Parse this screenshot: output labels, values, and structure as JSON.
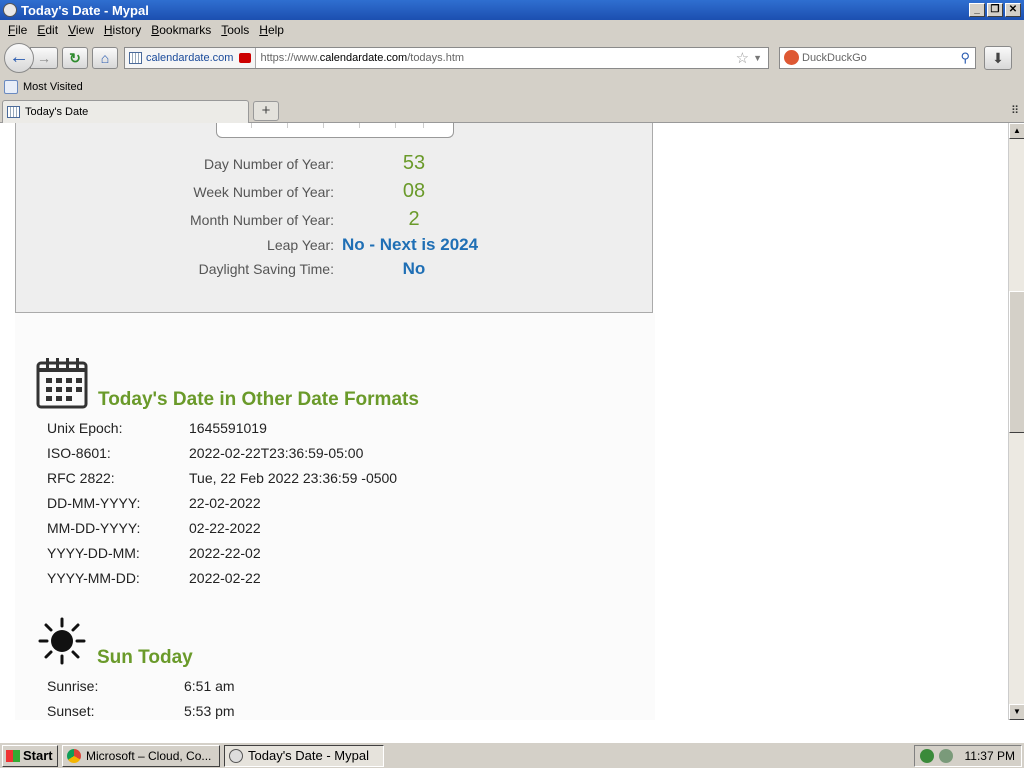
{
  "window": {
    "title": "Today's Date - Mypal"
  },
  "menu": [
    "File",
    "Edit",
    "View",
    "History",
    "Bookmarks",
    "Tools",
    "Help"
  ],
  "navbar": {
    "site_identity": "calendardate.com",
    "url_prefix": "https://www.",
    "url_domain": "calendardate.com",
    "url_path": "/todays.htm",
    "search_placeholder": "DuckDuckGo"
  },
  "bookmarks": {
    "most_visited": "Most Visited"
  },
  "tabs": [
    {
      "label": "Today's Date"
    }
  ],
  "stats": {
    "day_label": "Day Number of Year:",
    "day_value": "53",
    "week_label": "Week Number of Year:",
    "week_value": "08",
    "month_label": "Month Number of Year:",
    "month_value": "2",
    "leap_label": "Leap Year:",
    "leap_value": "No - Next is 2024",
    "dst_label": "Daylight Saving Time:",
    "dst_value": "No"
  },
  "formats": {
    "title": "Today's Date in Other Date Formats",
    "rows": [
      {
        "key": "Unix Epoch:",
        "value": "1645591019"
      },
      {
        "key": "ISO-8601:",
        "value": "2022-02-22T23:36:59-05:00"
      },
      {
        "key": "RFC 2822:",
        "value": "Tue, 22 Feb 2022 23:36:59 -0500"
      },
      {
        "key": "DD-MM-YYYY:",
        "value": "22-02-2022"
      },
      {
        "key": "MM-DD-YYYY:",
        "value": "02-22-2022"
      },
      {
        "key": "YYYY-DD-MM:",
        "value": "2022-22-02"
      },
      {
        "key": "YYYY-MM-DD:",
        "value": "2022-02-22"
      }
    ]
  },
  "sun": {
    "title": "Sun Today",
    "sunrise_label": "Sunrise:",
    "sunrise_value": "6:51 am",
    "sunset_label": "Sunset:",
    "sunset_value": "5:53 pm"
  },
  "taskbar": {
    "start": "Start",
    "tasks": [
      "Microsoft – Cloud, Co...",
      "Today's Date - Mypal"
    ],
    "clock": "11:37 PM"
  },
  "colors": {
    "green_accent": "#6a9a2a",
    "blue_accent": "#1f6fb5",
    "titlebar": "#1c4fb0"
  }
}
